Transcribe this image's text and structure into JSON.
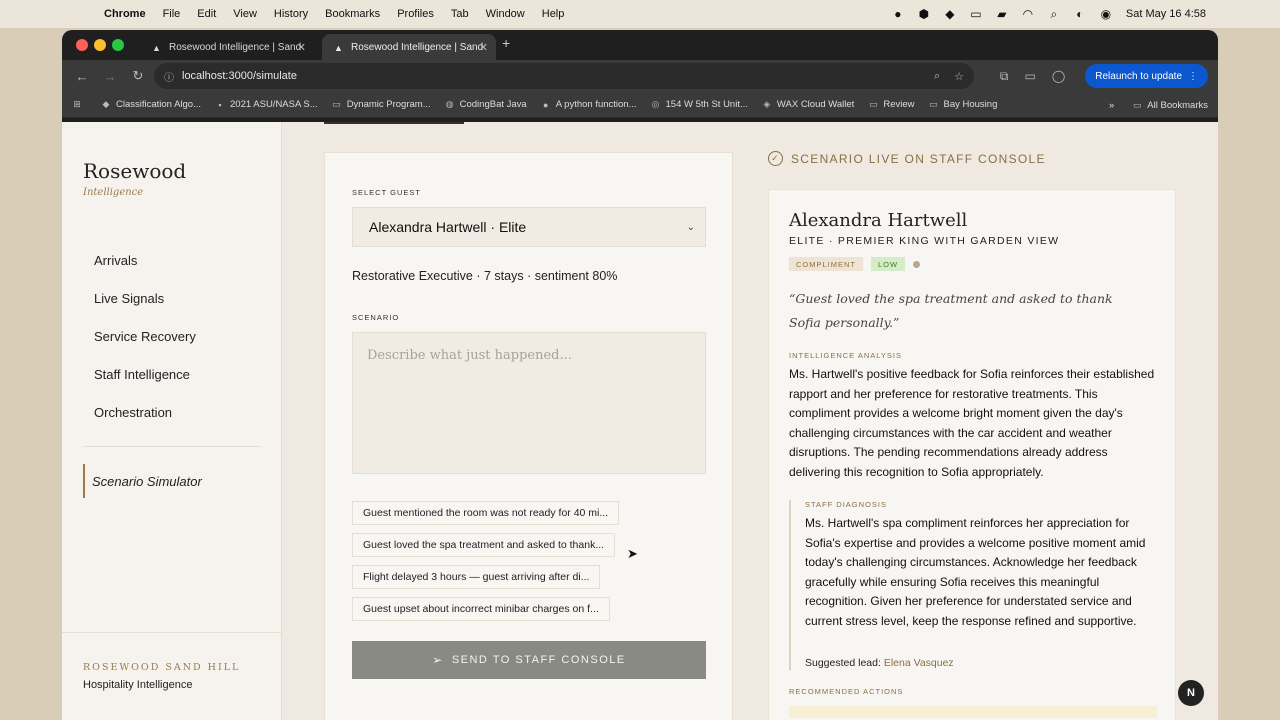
{
  "menubar": {
    "app": "Chrome",
    "items": [
      "File",
      "Edit",
      "View",
      "History",
      "Bookmarks",
      "Profiles",
      "Tab",
      "Window",
      "Help"
    ],
    "clock": "Sat May 16  4:58"
  },
  "browser": {
    "tabs": [
      {
        "title": "Rosewood Intelligence | Sand"
      },
      {
        "title": "Rosewood Intelligence | Sand"
      }
    ],
    "url": "localhost:3000/simulate",
    "relaunch_label": "Relaunch to update",
    "bookmarks": [
      {
        "icon": "shield-icon",
        "label": "Classification Algo..."
      },
      {
        "icon": "page-icon",
        "label": "2021 ASU/NASA S..."
      },
      {
        "icon": "folder-icon",
        "label": "Dynamic Program..."
      },
      {
        "icon": "globe-icon",
        "label": "CodingBat Java"
      },
      {
        "icon": "github-icon",
        "label": "A python function..."
      },
      {
        "icon": "page-icon",
        "label": "154 W 5th St Unit..."
      },
      {
        "icon": "wallet-icon",
        "label": "WAX Cloud Wallet"
      },
      {
        "icon": "folder-icon",
        "label": "Review"
      },
      {
        "icon": "folder-icon",
        "label": "Bay Housing"
      }
    ],
    "all_bookmarks": "All Bookmarks"
  },
  "sidebar": {
    "brand": "Rosewood",
    "brand_sub": "Intelligence",
    "nav": [
      "Arrivals",
      "Live Signals",
      "Service Recovery",
      "Staff Intelligence",
      "Orchestration"
    ],
    "active_item": "Scenario Simulator",
    "footer_title": "ROSEWOOD SAND HILL",
    "footer_sub": "Hospitality Intelligence"
  },
  "form": {
    "select_label": "SELECT GUEST",
    "selected_guest": "Alexandra Hartwell · Elite",
    "guest_meta": "Restorative Executive · 7 stays · sentiment 80%",
    "scenario_label": "SCENARIO",
    "scenario_placeholder": "Describe what just happened...",
    "chips": [
      "Guest mentioned the room was not ready for 40 mi...",
      "Guest loved the spa treatment and asked to thank...",
      "Flight delayed 3 hours — guest arriving after di...",
      "Guest upset about incorrect minibar charges on f..."
    ],
    "send_label": "SEND TO STAFF CONSOLE"
  },
  "result": {
    "status": "SCENARIO LIVE ON STAFF CONSOLE",
    "guest_name": "Alexandra Hartwell",
    "tier": "ELITE · PREMIER KING WITH GARDEN VIEW",
    "badge_type": "COMPLIMENT",
    "badge_priority": "LOW",
    "quote": "“Guest loved the spa treatment and asked to thank Sofia personally.”",
    "analysis_label": "INTELLIGENCE ANALYSIS",
    "analysis": "Ms. Hartwell's positive feedback for Sofia reinforces their established rapport and her preference for restorative treatments. This compliment provides a welcome bright moment given the day's challenging circumstances with the car accident and weather disruptions. The pending recommendations already address delivering this recognition to Sofia appropriately.",
    "diagnosis_label": "STAFF DIAGNOSIS",
    "diagnosis": "Ms. Hartwell's spa compliment reinforces her appreciation for Sofia's expertise and provides a welcome positive moment amid today's challenging circumstances. Acknowledge her feedback gracefully while ensuring Sofia receives this meaningful recognition. Given her preference for understated service and current stress level, keep the response refined and supportive.",
    "lead_label": "Suggested lead:",
    "lead_name": "Elena Vasquez",
    "recommended_label": "RECOMMENDED ACTIONS"
  },
  "dev_badge": "N"
}
